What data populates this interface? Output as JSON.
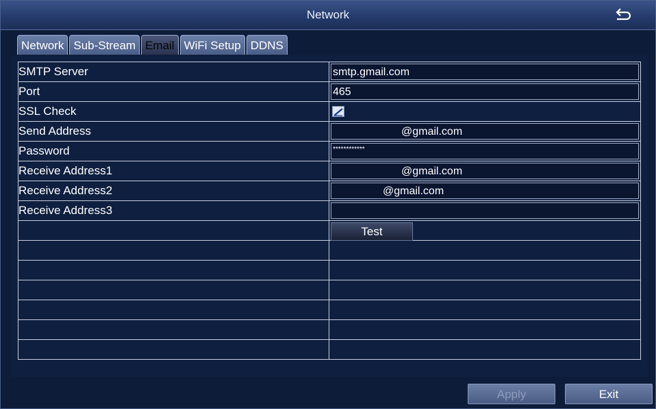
{
  "window": {
    "title": "Network"
  },
  "icons": {
    "back": "back-arrow-icon"
  },
  "tabs": [
    {
      "label": "Network",
      "active": false
    },
    {
      "label": "Sub-Stream",
      "active": false
    },
    {
      "label": "Email",
      "active": true
    },
    {
      "label": "WiFi Setup",
      "active": false
    },
    {
      "label": "DDNS",
      "active": false
    }
  ],
  "form": {
    "smtp_server": {
      "label": "SMTP Server",
      "value": "smtp.gmail.com"
    },
    "port": {
      "label": "Port",
      "value": "465"
    },
    "ssl_check": {
      "label": "SSL Check",
      "checked": true
    },
    "send_address": {
      "label": "Send Address",
      "value": "@gmail.com"
    },
    "password": {
      "label": "Password",
      "value": "************"
    },
    "receive_address1": {
      "label": "Receive Address1",
      "value": "@gmail.com"
    },
    "receive_address2": {
      "label": "Receive Address2",
      "value": "@gmail.com"
    },
    "receive_address3": {
      "label": "Receive Address3",
      "value": ""
    },
    "test_label": "Test"
  },
  "footer": {
    "apply_label": "Apply",
    "apply_enabled": false,
    "exit_label": "Exit"
  },
  "colors": {
    "background": "#0d1c38",
    "titlebar": "#2a4070",
    "tab": "#5a6d96",
    "border": "#c8d0e0"
  }
}
